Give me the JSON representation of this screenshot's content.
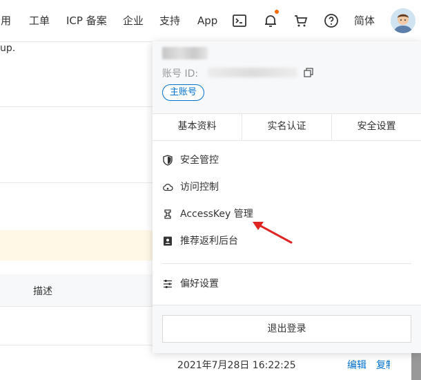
{
  "nav": {
    "items": [
      {
        "label": "费用"
      },
      {
        "label": "工单"
      },
      {
        "label": "ICP 备案"
      },
      {
        "label": "企业"
      },
      {
        "label": "支持"
      },
      {
        "label": "App"
      }
    ],
    "icons": [
      "terminal-icon",
      "bell-icon",
      "cart-icon",
      "help-icon"
    ],
    "lang_label": "简体",
    "accent_color": "#ff6a00"
  },
  "background": {
    "fragment_text": "up.",
    "table_header": "描述",
    "row_time": "2021年7月28日 16:22:25",
    "row_edit": "编辑",
    "row_more": "复制"
  },
  "account": {
    "id_label": "账号 ID:",
    "badge": "主账号",
    "badge_color": "#0070cc"
  },
  "tabs": [
    {
      "label": "基本资料"
    },
    {
      "label": "实名认证"
    },
    {
      "label": "安全设置"
    }
  ],
  "menu": [
    {
      "label": "安全管控",
      "icon": "shield-icon"
    },
    {
      "label": "访问控制",
      "icon": "cloud-icon"
    },
    {
      "label": "AccessKey 管理",
      "icon": "key-icon"
    },
    {
      "label": "推荐返利后台",
      "icon": "rebate-icon"
    },
    {
      "label": "偏好设置",
      "icon": "sliders-icon"
    }
  ],
  "logout_label": "退出登录",
  "annotation": {
    "arrow_color": "#e02424"
  }
}
